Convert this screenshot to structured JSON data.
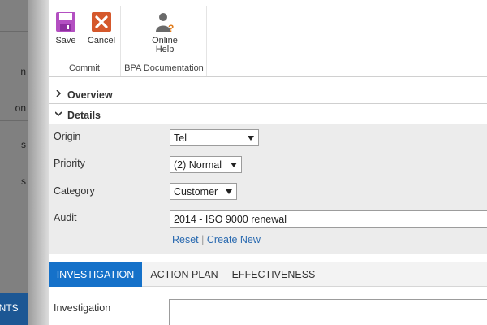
{
  "background_app": {
    "nav_fragments": [
      "n",
      "on",
      "s",
      "s"
    ],
    "bottom_button": "UNTS"
  },
  "ribbon": {
    "groups": [
      {
        "label": "Commit",
        "buttons": [
          {
            "label": "Save",
            "icon": "save-icon",
            "color": "#b34fc1"
          },
          {
            "label": "Cancel",
            "icon": "cancel-icon",
            "color": "#d5582c"
          }
        ]
      },
      {
        "label": "BPA Documentation",
        "buttons": [
          {
            "label_line1": "Online",
            "label_line2": "Help",
            "icon": "online-help-icon",
            "color": "#e07c1c"
          }
        ]
      }
    ]
  },
  "sections": {
    "overview": {
      "title": "Overview",
      "expanded": false
    },
    "details": {
      "title": "Details",
      "expanded": true
    }
  },
  "details": {
    "origin": {
      "label": "Origin",
      "value": "Tel"
    },
    "priority": {
      "label": "Priority",
      "value": "(2) Normal"
    },
    "category": {
      "label": "Category",
      "value": "Customer"
    },
    "audit": {
      "label": "Audit",
      "value": "2014 - ISO 9000 renewal"
    },
    "links": {
      "reset": "Reset",
      "separator": "|",
      "create_new": "Create New"
    }
  },
  "tabs": [
    {
      "label": "INVESTIGATION",
      "active": true
    },
    {
      "label": "ACTION PLAN",
      "active": false
    },
    {
      "label": "EFFECTIVENESS",
      "active": false
    }
  ],
  "investigation": {
    "label": "Investigation",
    "value": ""
  },
  "colors": {
    "accent": "#1571c9",
    "link": "#2a6ab0",
    "panel": "#ececec"
  }
}
